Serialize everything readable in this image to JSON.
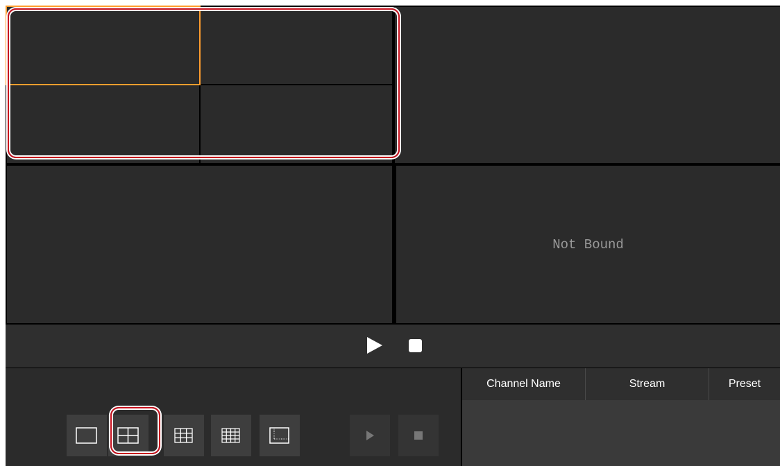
{
  "video_grid": {
    "panes": [
      {
        "label": ""
      },
      {
        "label": ""
      },
      {
        "label": ""
      },
      {
        "label": ""
      },
      {
        "label": ""
      },
      {
        "label": ""
      },
      {
        "label": "Not Bound"
      }
    ]
  },
  "playback": {
    "play_icon": "play-icon",
    "stop_icon": "stop-icon"
  },
  "layout_toolbar": {
    "buttons": [
      "1-split-icon",
      "4-split-icon",
      "9-split-icon",
      "16-split-icon",
      "custom-split-icon"
    ],
    "selected": "4-split-icon"
  },
  "channel_table": {
    "columns": [
      "Channel Name",
      "Stream",
      "Preset"
    ]
  },
  "colors": {
    "selection": "#ff9d2e",
    "annotation": "#c7101d",
    "pane_bg": "#2b2b2b"
  }
}
